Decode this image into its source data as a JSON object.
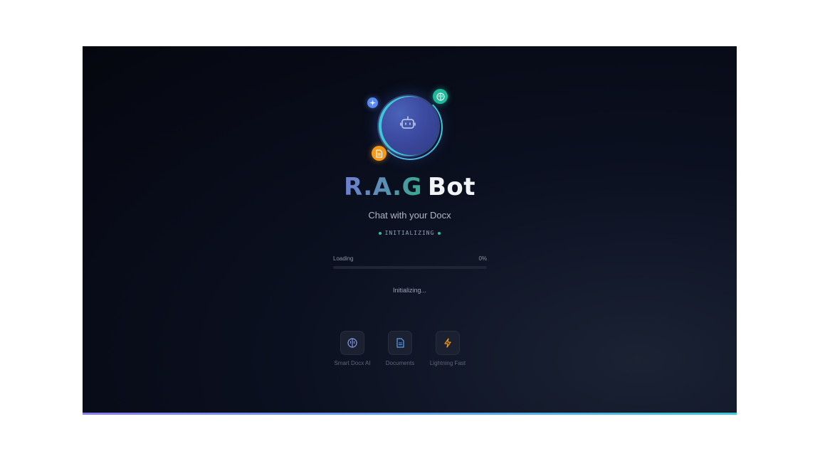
{
  "app": {
    "title_part1": "R.A.G",
    "title_part2": "Bot",
    "subtitle": "Chat with your Docx",
    "status": "INITIALIZING"
  },
  "progress": {
    "label": "Loading",
    "percent_text": "0%",
    "value": 0,
    "message": "Initializing..."
  },
  "features": [
    {
      "label": "Smart Docx AI",
      "icon": "brain-icon",
      "color": "#8a7cf0"
    },
    {
      "label": "Documents",
      "icon": "document-icon",
      "color": "#5c9ef0"
    },
    {
      "label": "Lightning Fast",
      "icon": "lightning-icon",
      "color": "#f29a1c"
    }
  ],
  "colors": {
    "accent_blue": "#5a8af0",
    "accent_green": "#1fb89a",
    "accent_orange": "#f29a1c",
    "status_dot": "#2fbf9c"
  }
}
